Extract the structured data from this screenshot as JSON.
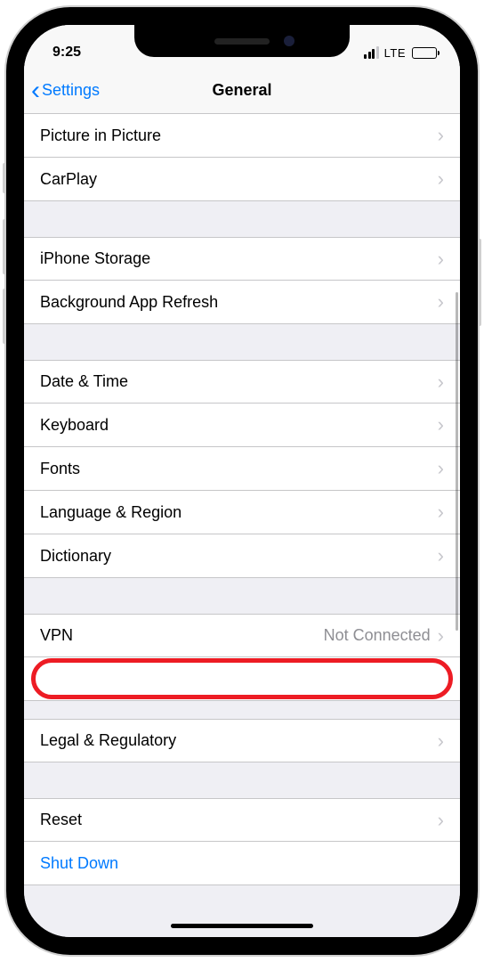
{
  "status": {
    "time": "9:25",
    "network": "LTE"
  },
  "nav": {
    "back": "Settings",
    "title": "General"
  },
  "groups": [
    {
      "rows": [
        {
          "label": "Picture in Picture",
          "chevron": true
        },
        {
          "label": "CarPlay",
          "chevron": true
        }
      ]
    },
    {
      "rows": [
        {
          "label": "iPhone Storage",
          "chevron": true
        },
        {
          "label": "Background App Refresh",
          "chevron": true
        }
      ]
    },
    {
      "rows": [
        {
          "label": "Date & Time",
          "chevron": true
        },
        {
          "label": "Keyboard",
          "chevron": true
        },
        {
          "label": "Fonts",
          "chevron": true
        },
        {
          "label": "Language & Region",
          "chevron": true
        },
        {
          "label": "Dictionary",
          "chevron": true
        }
      ]
    },
    {
      "rows": [
        {
          "label": "VPN",
          "value": "Not Connected",
          "chevron": true
        },
        {
          "label": "",
          "chevron": false,
          "highlighted": true
        }
      ]
    },
    {
      "rows": [
        {
          "label": "Legal & Regulatory",
          "chevron": true
        }
      ]
    },
    {
      "rows": [
        {
          "label": "Reset",
          "chevron": true
        },
        {
          "label": "Shut Down",
          "chevron": false,
          "action": true
        }
      ]
    }
  ]
}
